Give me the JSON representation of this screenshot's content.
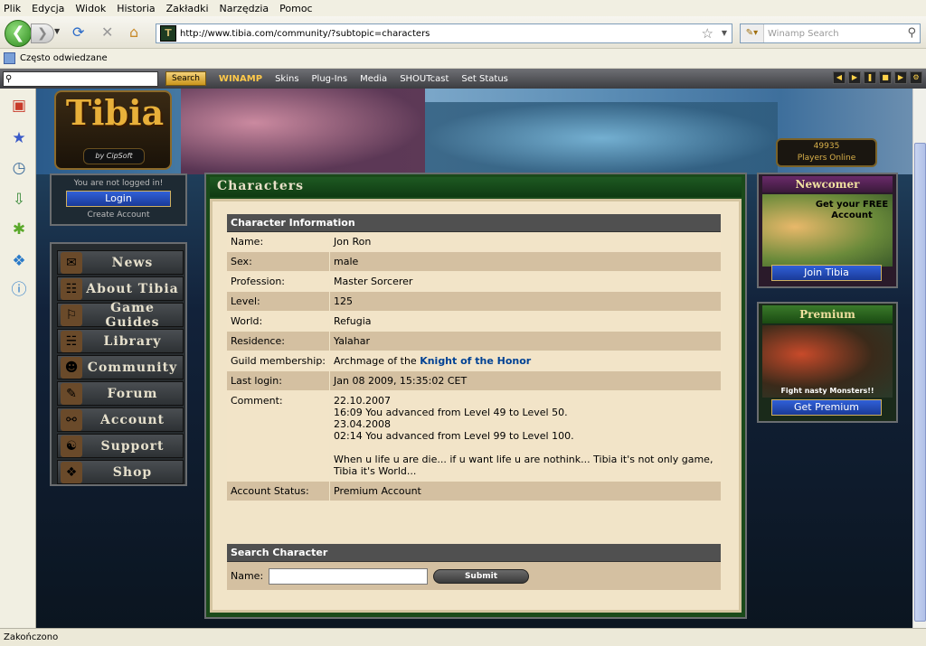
{
  "browser": {
    "menus": [
      "Plik",
      "Edycja",
      "Widok",
      "Historia",
      "Zakładki",
      "Narzędzia",
      "Pomoc"
    ],
    "url": "http://www.tibia.com/community/?subtopic=characters",
    "search_placeholder": "Winamp Search",
    "bookmark": "Często odwiedzane",
    "status": "Zakończono"
  },
  "winamp": {
    "search_button": "Search",
    "brand": "WINAMP",
    "items": [
      "Skins",
      "Plug-Ins",
      "Media",
      "SHOUTcast",
      "Set Status"
    ]
  },
  "site": {
    "logo": "Tibia",
    "logo_sub": "by CipSoft",
    "players_count": "49935",
    "players_label": "Players Online",
    "login": {
      "status": "You are not logged in!",
      "login_button": "Login",
      "create_account": "Create Account"
    },
    "menu": [
      "News",
      "About Tibia",
      "Game Guides",
      "Library",
      "Community",
      "Forum",
      "Account",
      "Support",
      "Shop"
    ],
    "newcomer": {
      "title": "Newcomer",
      "text": "Get your FREE Account",
      "button": "Join Tibia"
    },
    "premium": {
      "title": "Premium",
      "text": "Fight nasty Monsters!!",
      "button": "Get Premium"
    }
  },
  "page": {
    "title": "Characters",
    "char_info_header": "Character Information",
    "rows": [
      {
        "label": "Name:",
        "value": "Jon Ron"
      },
      {
        "label": "Sex:",
        "value": "male"
      },
      {
        "label": "Profession:",
        "value": "Master Sorcerer"
      },
      {
        "label": "Level:",
        "value": "125"
      },
      {
        "label": "World:",
        "value": "Refugia"
      },
      {
        "label": "Residence:",
        "value": "Yalahar"
      },
      {
        "label": "Guild membership:",
        "value_prefix": "Archmage of the ",
        "value_link": "Knight of the Honor"
      },
      {
        "label": "Last login:",
        "value": "Jan 08 2009, 15:35:02 CET"
      },
      {
        "label": "Comment:",
        "value": "22.10.2007\n16:09 You advanced from Level 49 to Level 50.\n23.04.2008\n02:14 You advanced from Level 99 to Level 100.\n\nWhen u life u are die... if u want life u are nothink... Tibia it's not only game, Tibia it's World..."
      },
      {
        "label": "Account Status:",
        "value": "Premium Account"
      }
    ],
    "search_header": "Search Character",
    "search_label": "Name:",
    "search_button": "Submit"
  }
}
